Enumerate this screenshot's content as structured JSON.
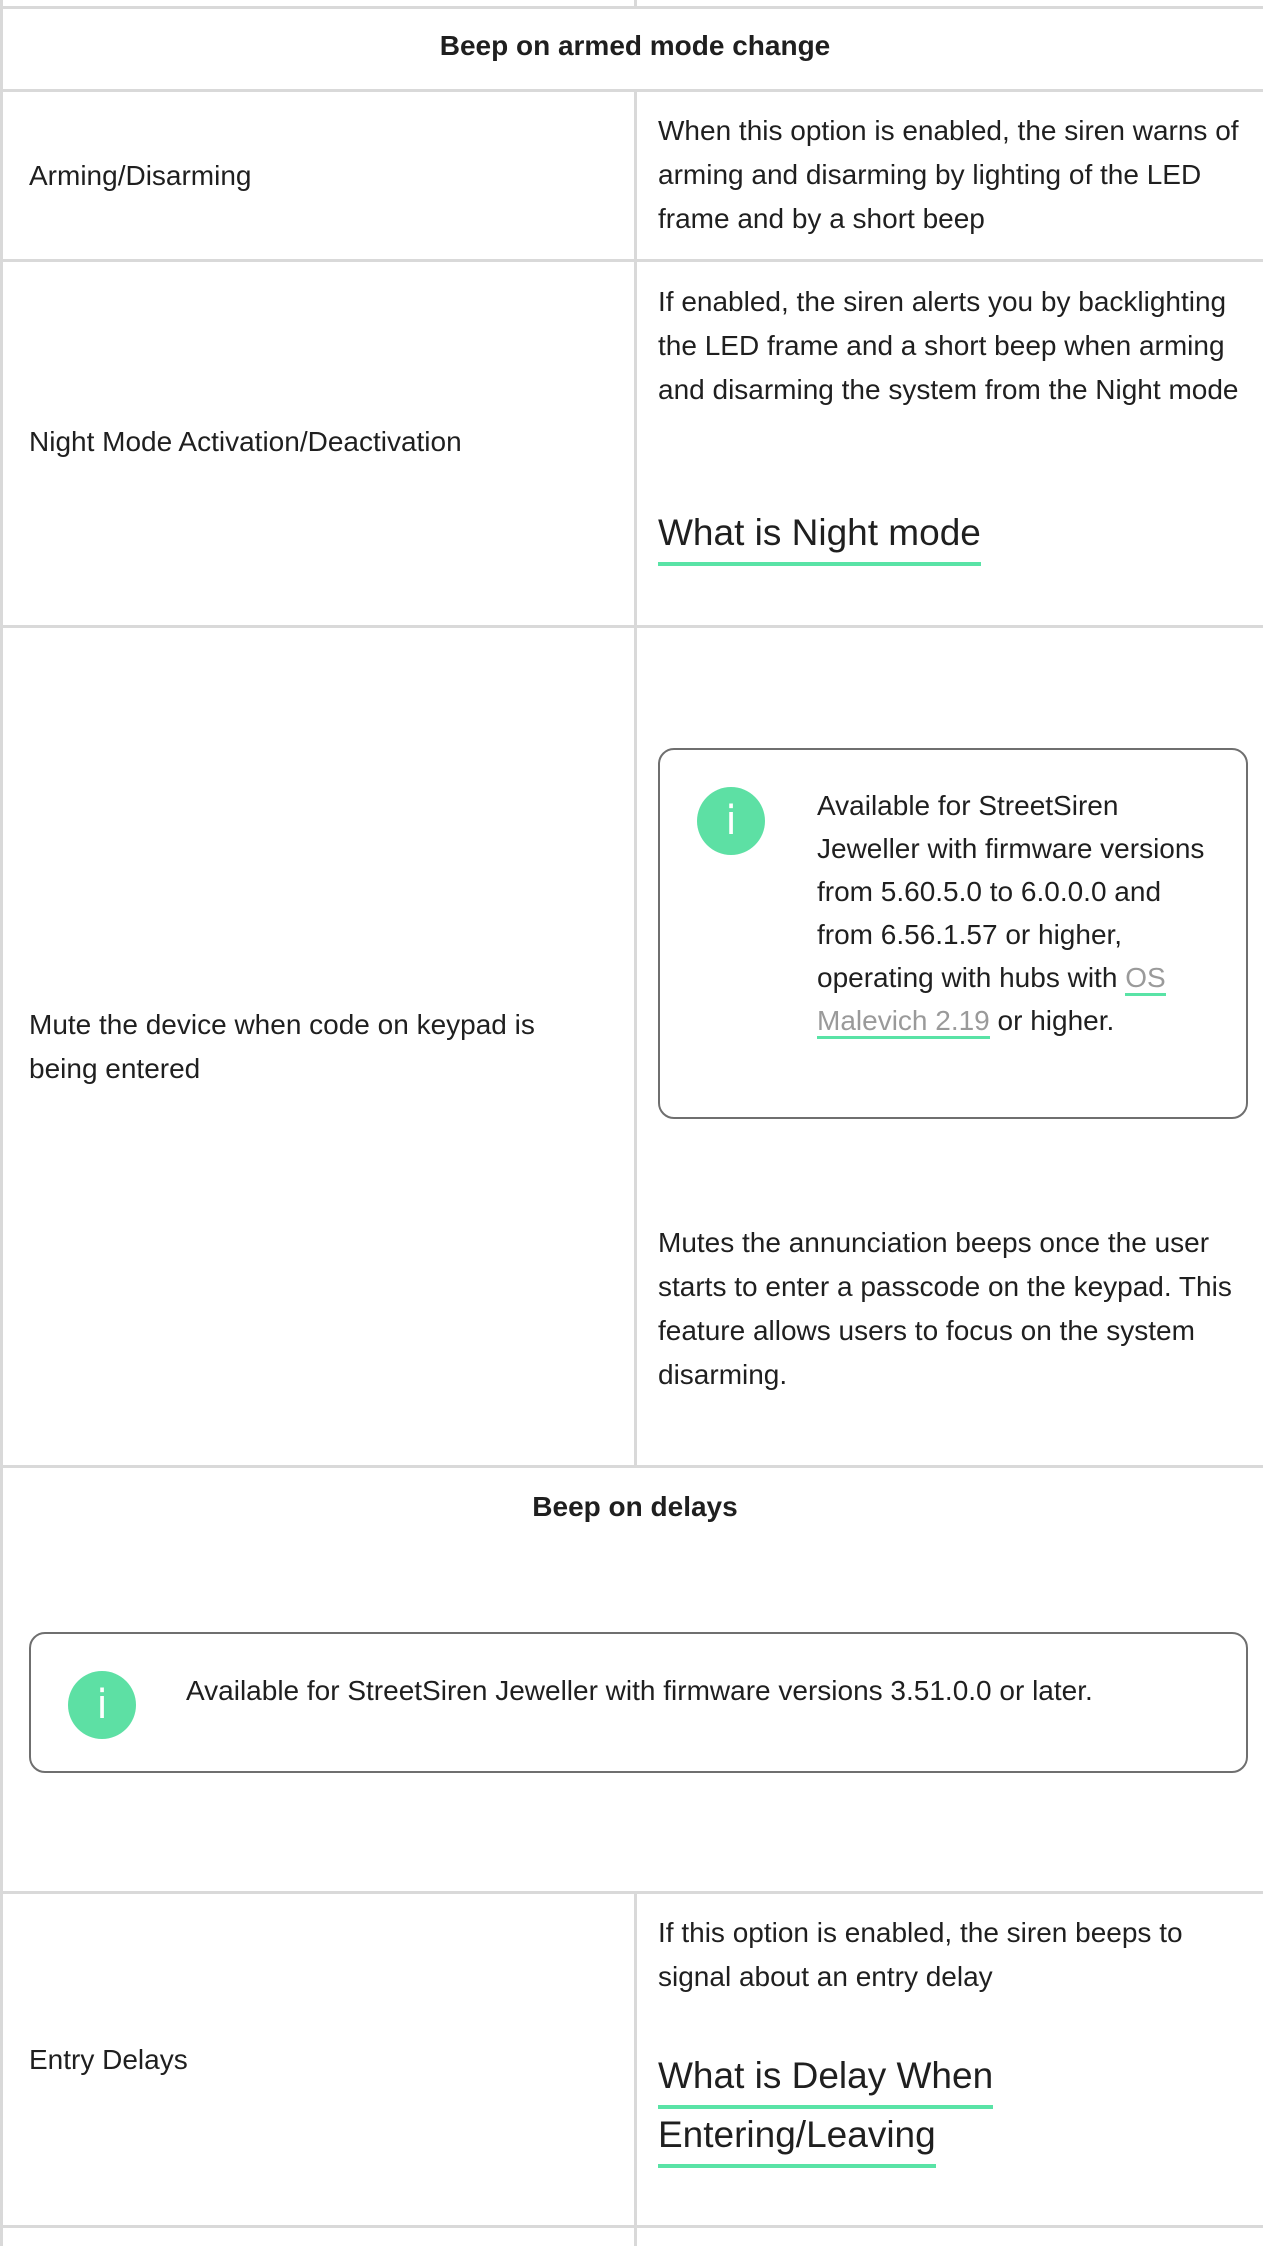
{
  "table": {
    "section_armed": "Beep on armed mode change",
    "rows": [
      {
        "label": "Arming/Disarming",
        "desc": "When this option is enabled, the siren warns of arming and disarming by lighting of the LED frame and by a short beep"
      },
      {
        "label": "Night Mode Activation/Deactivation",
        "desc": "If enabled, the siren alerts you by backlighting the LED frame and a short beep when arming and disarming the system from the Night mode",
        "link": "What is Night mode"
      },
      {
        "label": "Mute the device when code on keypad is being entered",
        "note_before": "Available for StreetSiren Jeweller with firmware versions from 5.60.5.0 to 6.0.0.0 and from 6.56.1.57 or higher, operating with hubs with ",
        "note_link": "OS Malevich 2.19",
        "note_after": " or higher.",
        "desc": "Mutes the annunciation beeps once the user starts to enter a passcode on the keypad. This feature allows users to focus on the system disarming."
      }
    ],
    "section_delays": "Beep on delays",
    "delays_note": "Available for StreetSiren Jeweller with firmware versions 3.51.0.0 or later.",
    "entry_row": {
      "label": "Entry Delays",
      "desc": "If this option is enabled, the siren beeps to signal about an entry delay",
      "link_line1": "What is Delay When",
      "link_line2": "Entering/Leaving"
    }
  },
  "icons": {
    "info": "info-icon",
    "info_glyph": "i"
  },
  "colors": {
    "accent": "#59e3a6",
    "icon_bg": "#5de0a4",
    "border": "#d9d9d9",
    "link_gray": "#9a9a9a"
  }
}
